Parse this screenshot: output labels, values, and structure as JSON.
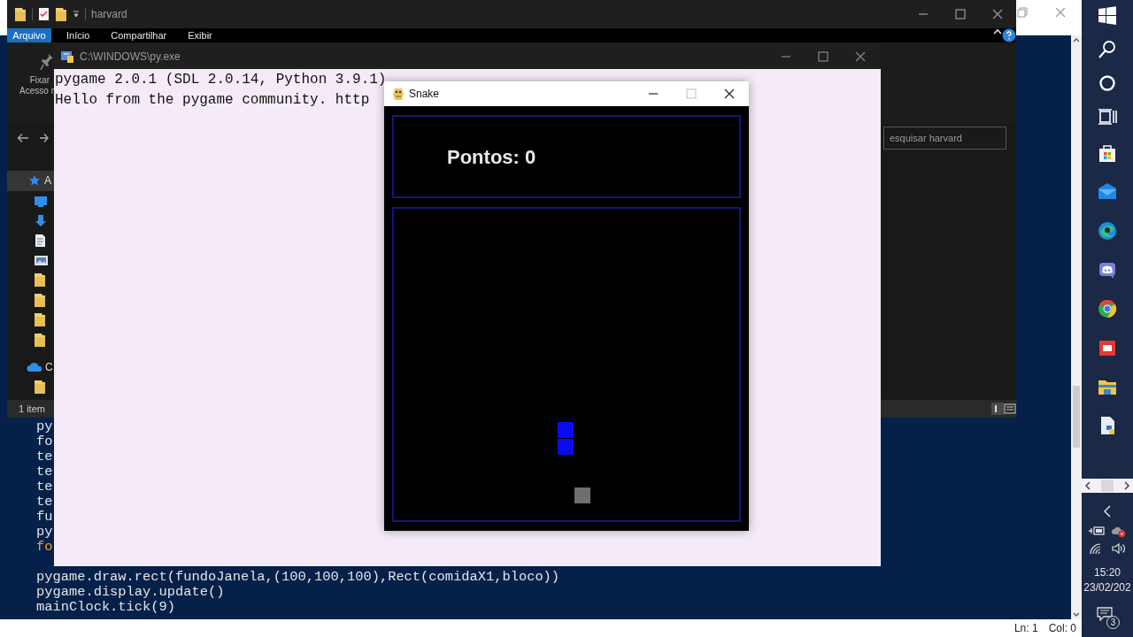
{
  "editor": {
    "code_lines": [
      {
        "text": "py",
        "kind": "plain"
      },
      {
        "text": "fo",
        "kind": "plain"
      },
      {
        "text": "te",
        "kind": "plain"
      },
      {
        "text": "te",
        "kind": "plain"
      },
      {
        "text": "te",
        "kind": "plain"
      },
      {
        "text": "te",
        "kind": "plain"
      },
      {
        "text": "fu",
        "kind": "plain"
      },
      {
        "text": "py",
        "kind": "plain"
      },
      {
        "text": "fo",
        "kind": "keyword"
      },
      {
        "kind": "blank"
      },
      {
        "text": "pygame.draw.rect(fundoJanela,(100,100,100),Rect(comidaX1,bloco))",
        "kind": "plain"
      },
      {
        "text": "pygame.display.update()",
        "kind": "plain"
      },
      {
        "text": "mainClock.tick(9)",
        "kind": "plain"
      }
    ],
    "status_bar": {
      "line": "Ln: 1",
      "column": "Col: 0"
    }
  },
  "explorer": {
    "title": "harvard",
    "ribbon_tabs": [
      {
        "label": "Arquivo",
        "selected": true
      },
      {
        "label": "Início",
        "selected": false
      },
      {
        "label": "Compartilhar",
        "selected": false
      },
      {
        "label": "Exibir",
        "selected": false
      }
    ],
    "ribbon_button": {
      "line_1": "Fixar",
      "line_2": "Acesso r"
    },
    "search": {
      "placeholder": "esquisar harvard"
    },
    "sidebar_items": [
      {
        "kind": "quick-access",
        "label": "A",
        "selected": true
      },
      {
        "kind": "desktop",
        "selected": false
      },
      {
        "kind": "downloads",
        "selected": false
      },
      {
        "kind": "documents",
        "selected": false
      },
      {
        "kind": "pictures",
        "selected": false
      },
      {
        "kind": "folder",
        "selected": false
      },
      {
        "kind": "folder",
        "selected": false
      },
      {
        "kind": "folder",
        "selected": false
      },
      {
        "kind": "folder",
        "selected": false
      },
      {
        "kind": "onedrive",
        "label": "C",
        "selected": false
      },
      {
        "kind": "folder",
        "selected": false
      }
    ],
    "status_bar": "1 item"
  },
  "console": {
    "title": "C:\\WINDOWS\\py.exe",
    "lines": [
      "pygame 2.0.1 (SDL 2.0.14, Python 3.9.1)",
      "Hello from the pygame community. http"
    ]
  },
  "game_window": {
    "title": "Snake",
    "maximize_disabled": true,
    "score": "Pontos: 0"
  },
  "taskbar": {
    "apps": [
      {
        "kind": "start"
      },
      {
        "kind": "search"
      },
      {
        "kind": "cortana"
      },
      {
        "kind": "task-view"
      },
      {
        "kind": "store"
      },
      {
        "kind": "mail"
      },
      {
        "kind": "edge"
      },
      {
        "kind": "discord"
      },
      {
        "kind": "chrome"
      },
      {
        "kind": "slides"
      },
      {
        "kind": "file-explorer"
      },
      {
        "kind": "python-file"
      }
    ],
    "time": "15:20",
    "date": "23/02/202",
    "notification_count": "3"
  }
}
